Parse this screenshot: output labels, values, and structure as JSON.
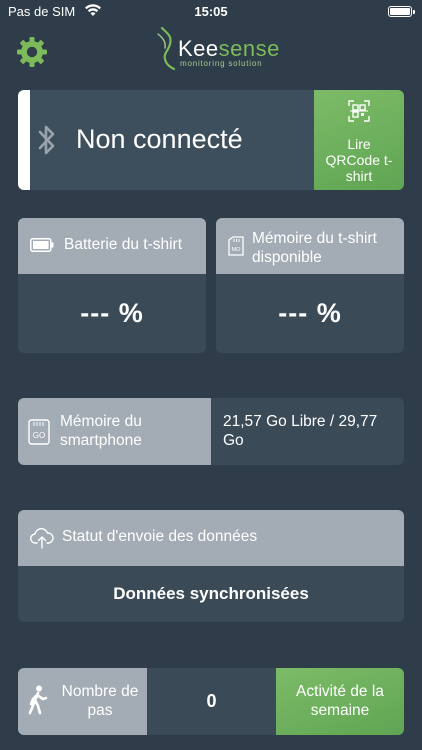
{
  "status_bar": {
    "carrier": "Pas de SIM",
    "time": "15:05"
  },
  "app": {
    "logo_prefix": "Kee",
    "logo_suffix": "sense",
    "tagline": "monitoring solution"
  },
  "colors": {
    "background": "#2e3d49",
    "card": "#3a4a57",
    "card_header": "#a3acb4",
    "accent_green": "#6db25d",
    "logo_green": "#7cba5a"
  },
  "connection": {
    "status": "Non connecté",
    "qr_button": "Lire QRCode t-shirt",
    "icon": "bluetooth-icon"
  },
  "battery": {
    "label": "Batterie du t-shirt",
    "value": "--- %",
    "icon": "battery-icon"
  },
  "tshirt_memory": {
    "label": "Mémoire du t-shirt disponible",
    "value": "--- %",
    "icon": "memory-card-icon"
  },
  "phone_memory": {
    "label": "Mémoire du smartphone",
    "value": "21,57 Go Libre / 29,77 Go",
    "icon_text": "GO",
    "icon": "storage-icon"
  },
  "sync": {
    "label": "Statut d'envoie des données",
    "value": "Données synchronisées",
    "icon": "cloud-upload-icon"
  },
  "steps": {
    "label": "Nombre de pas",
    "count": "0",
    "week_button": "Activité de la semaine",
    "icon": "walking-icon"
  }
}
